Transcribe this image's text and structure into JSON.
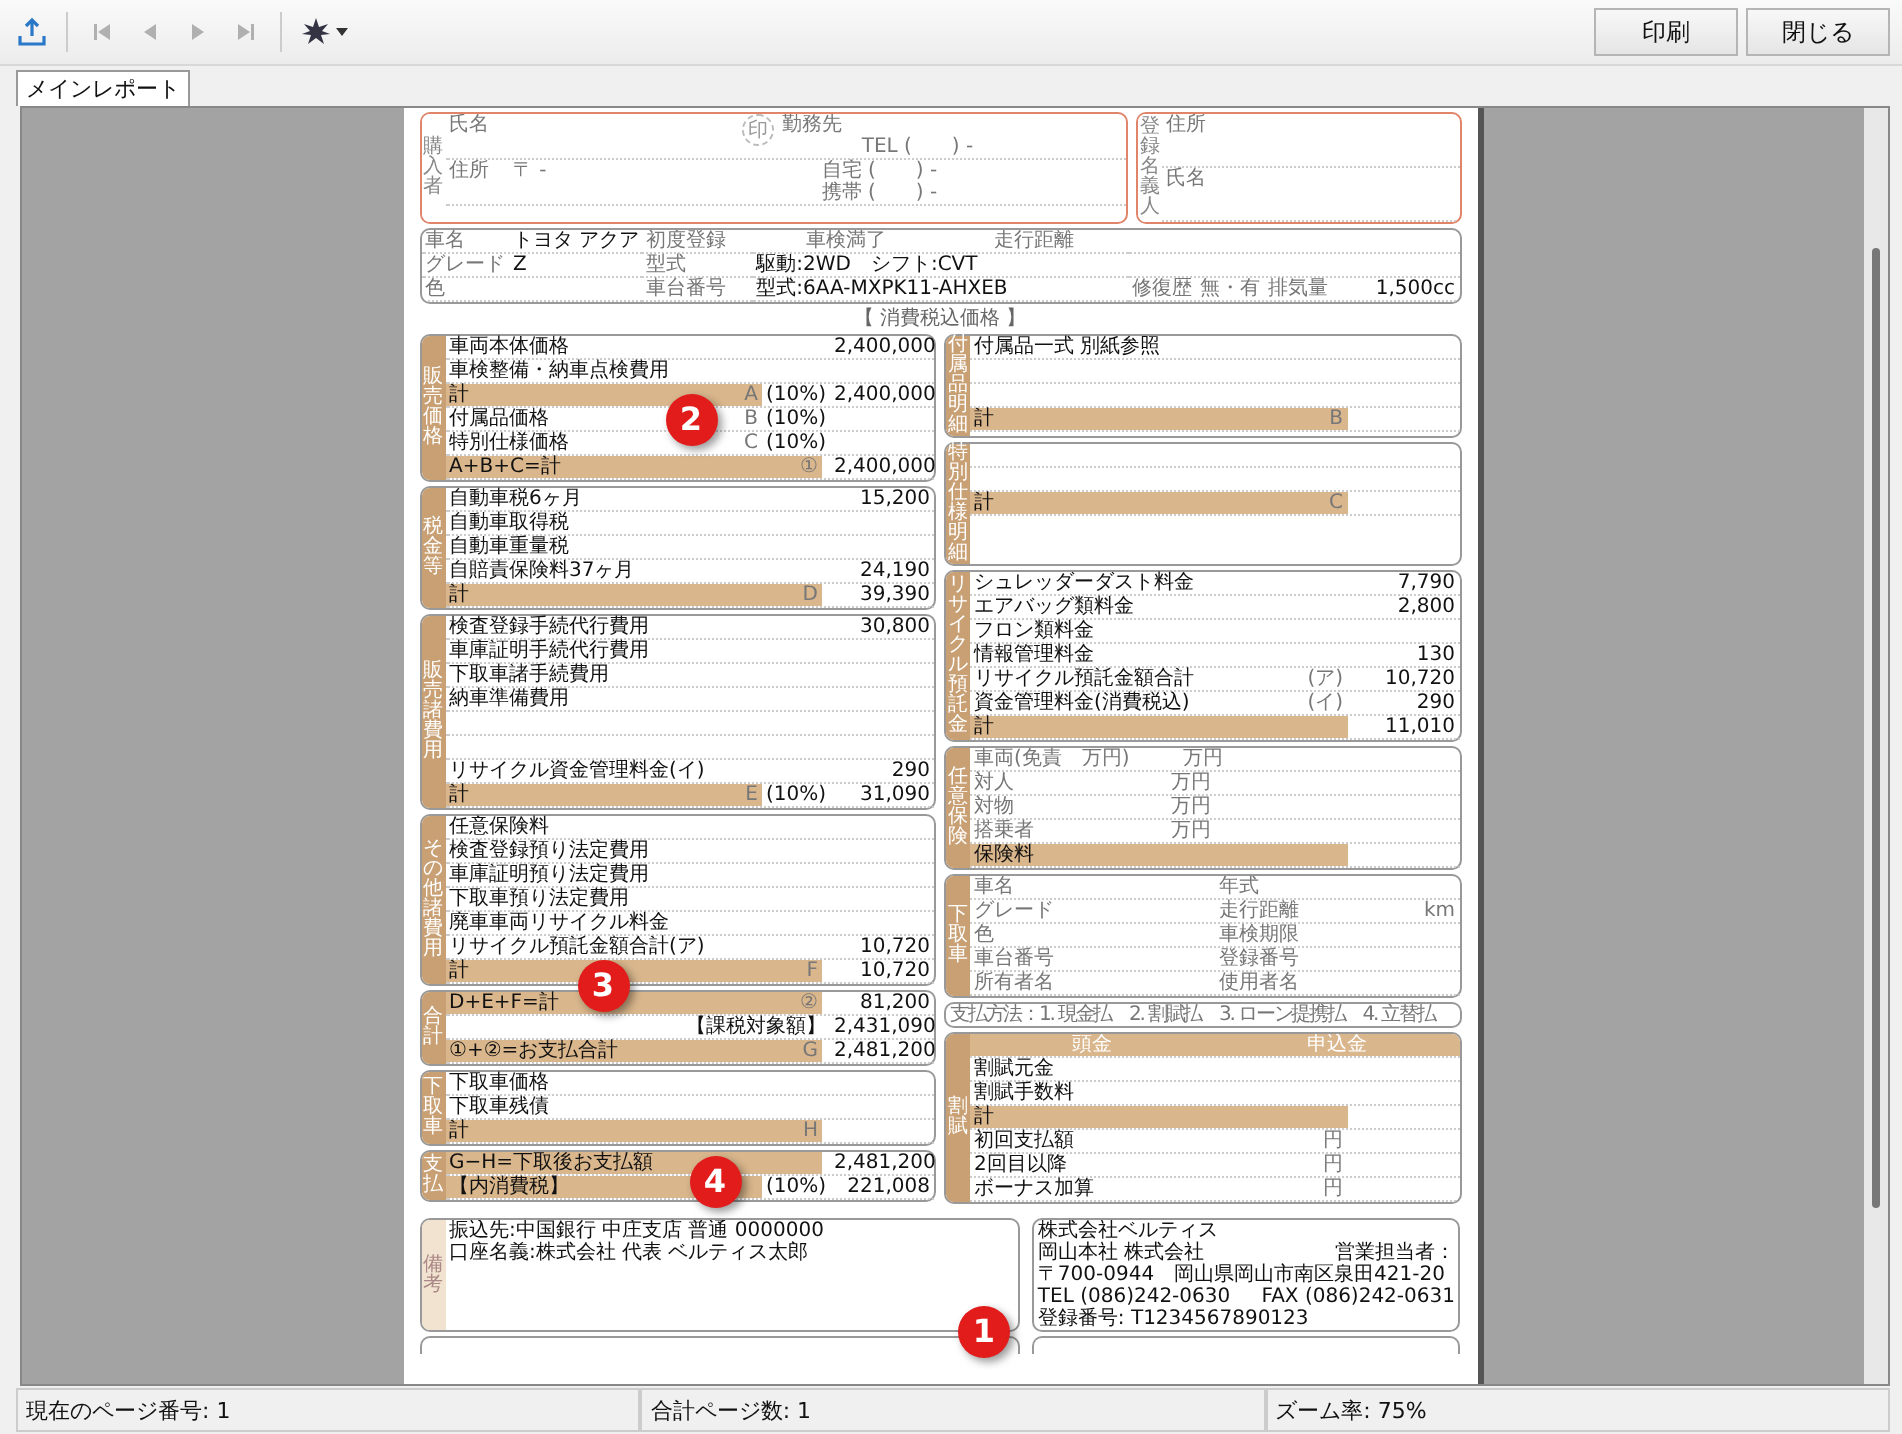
{
  "toolbar": {
    "tools": [
      {
        "kind": "export",
        "disabled": false
      },
      {
        "kind": "first",
        "disabled": true
      },
      {
        "kind": "prev",
        "disabled": true
      },
      {
        "kind": "next",
        "disabled": true
      },
      {
        "kind": "last",
        "disabled": true
      },
      {
        "kind": "zoom",
        "disabled": false
      }
    ],
    "buttons": [
      "印刷",
      "閉じる"
    ]
  },
  "tabs": [
    {
      "label": "メインレポート",
      "selected": true
    }
  ],
  "document": {
    "buyer": {
      "title": "購入者",
      "name_label": "氏名",
      "seal": "印",
      "workplace_label": "勤務先",
      "work_tel": "TEL (　　) -",
      "address_label": "住所",
      "postal": "〒 -",
      "home_tel": "自宅 (　　) -",
      "mobile_tel": "携帯 (　　) -"
    },
    "registrant": {
      "title": "登録名義人",
      "address_label": "住所",
      "name_label": "氏名"
    },
    "vehicle": {
      "name_label": "車名",
      "name": "トヨタ アクア",
      "grade_label": "グレード",
      "grade": "Z",
      "color_label": "色",
      "reg_labels": [
        "初度登録",
        "型式",
        "車台番号"
      ],
      "spec_lines": [
        "駆動:2WD　シフト:CVT",
        "型式:6AA-MXPK11-AHXEB"
      ],
      "head_labels": [
        "車検満了",
        "走行距離"
      ],
      "repair_label": "修復歴",
      "repair_value": "無・有",
      "displacement_label": "排気量",
      "displacement": "1,500cc"
    },
    "price_note": "【 消費税込価格 】",
    "left_sections": [
      {
        "title": "販売価格",
        "rows": [
          {
            "kind": "item",
            "label": "車両本体価格",
            "amount": "2,400,000"
          },
          {
            "kind": "item",
            "label": "車検整備・納車点検費用"
          },
          {
            "kind": "total",
            "label": "計",
            "mark": "A",
            "tax": "(10%)",
            "amount": "2,400,000"
          },
          {
            "kind": "item",
            "label": "付属品価格",
            "mark": "B",
            "tax": "(10%)"
          },
          {
            "kind": "item",
            "label": "特別仕様価格",
            "mark": "C",
            "tax": "(10%)"
          },
          {
            "kind": "total",
            "label": "A+B+C=計",
            "mark": "①",
            "amount": "2,400,000"
          }
        ]
      },
      {
        "title": "税金等",
        "rows": [
          {
            "kind": "item",
            "label": "自動車税6ヶ月",
            "amount": "15,200"
          },
          {
            "kind": "item",
            "label": "自動車取得税"
          },
          {
            "kind": "item",
            "label": "自動車重量税"
          },
          {
            "kind": "item",
            "label": "自賠責保険料37ヶ月",
            "amount": "24,190"
          },
          {
            "kind": "total",
            "label": "計",
            "mark": "D",
            "amount": "39,390"
          }
        ]
      },
      {
        "title": "販売諸費用",
        "rows": [
          {
            "kind": "item",
            "label": "検査登録手続代行費用",
            "amount": "30,800"
          },
          {
            "kind": "item",
            "label": "車庫証明手続代行費用"
          },
          {
            "kind": "item",
            "label": "下取車諸手続費用"
          },
          {
            "kind": "item",
            "label": "納車準備費用"
          },
          {
            "kind": "blank"
          },
          {
            "kind": "blank"
          },
          {
            "kind": "item",
            "label": "リサイクル資金管理料金(イ)",
            "amount": "290"
          },
          {
            "kind": "total",
            "label": "計",
            "mark": "E",
            "tax": "(10%)",
            "amount": "31,090"
          }
        ]
      },
      {
        "title": "その他諸費用",
        "rows": [
          {
            "kind": "item",
            "label": "任意保険料"
          },
          {
            "kind": "item",
            "label": "検査登録預り法定費用"
          },
          {
            "kind": "item",
            "label": "車庫証明預り法定費用"
          },
          {
            "kind": "item",
            "label": "下取車預り法定費用"
          },
          {
            "kind": "item",
            "label": "廃車車両リサイクル料金"
          },
          {
            "kind": "item",
            "label": "リサイクル預託金額合計(ア)",
            "amount": "10,720"
          },
          {
            "kind": "total",
            "label": "計",
            "mark": "F",
            "amount": "10,720"
          }
        ]
      },
      {
        "title": "合計",
        "rows": [
          {
            "kind": "total",
            "label": "D+E+F=計",
            "mark": "②",
            "amount": "81,200"
          },
          {
            "kind": "item",
            "tax": "【課税対象額】",
            "amount": "2,431,090"
          },
          {
            "kind": "total",
            "label": "①+②=お支払合計",
            "mark": "G",
            "amount": "2,481,200"
          }
        ]
      },
      {
        "title": "下取車",
        "rows": [
          {
            "kind": "item",
            "label": "下取車価格"
          },
          {
            "kind": "item",
            "label": "下取車残債"
          },
          {
            "kind": "total",
            "label": "計",
            "mark": "H"
          }
        ]
      },
      {
        "title": "支払",
        "rows": [
          {
            "kind": "total",
            "label": "G−H=下取後お支払額",
            "amount": "2,481,200"
          },
          {
            "kind": "total",
            "label": "【内消費税】",
            "tax": "(10%)",
            "amount": "221,008"
          }
        ]
      }
    ],
    "right_sections": [
      {
        "title": "付属品明細",
        "rows": [
          {
            "kind": "item",
            "label": "付属品一式 別紙参照"
          },
          {
            "kind": "blank"
          },
          {
            "kind": "blank"
          },
          {
            "kind": "total",
            "label": "計",
            "mark": "B"
          }
        ]
      },
      {
        "title": "特別仕様明細",
        "rows": [
          {
            "kind": "blank"
          },
          {
            "kind": "blank"
          },
          {
            "kind": "total",
            "label": "計",
            "mark": "C"
          }
        ]
      },
      {
        "title": "リサイクル預託金",
        "rows": [
          {
            "kind": "item",
            "label": "シュレッダーダスト料金",
            "amount": "7,790"
          },
          {
            "kind": "item",
            "label": "エアバッグ類料金",
            "amount": "2,800"
          },
          {
            "kind": "item",
            "label": "フロン類料金"
          },
          {
            "kind": "item",
            "label": "情報管理料金",
            "amount": "130"
          },
          {
            "kind": "item",
            "label": "リサイクル預託金額合計",
            "mark": "(ア)",
            "amount": "10,720"
          },
          {
            "kind": "item",
            "label": "資金管理料金(消費税込)",
            "mark": "(イ)",
            "amount": "290"
          },
          {
            "kind": "total",
            "label": "計",
            "amount": "11,010"
          }
        ]
      },
      {
        "title": "任意保険",
        "rows": [
          {
            "kind": "pair",
            "label": "車両(免責　万円)",
            "value": "万円"
          },
          {
            "kind": "pair",
            "label": "対人",
            "value": "万円"
          },
          {
            "kind": "pair",
            "label": "対物",
            "value": "万円"
          },
          {
            "kind": "pair",
            "label": "搭乗者",
            "value": "万円"
          },
          {
            "kind": "total",
            "label": "保険料"
          }
        ]
      },
      {
        "title": "下取車",
        "rows": [
          {
            "kind": "pair",
            "label": "車名",
            "label2": "年式"
          },
          {
            "kind": "pair",
            "label": "グレード",
            "label2": "走行距離",
            "value2": "km"
          },
          {
            "kind": "pair",
            "label": "色",
            "label2": "車検期限"
          },
          {
            "kind": "pair",
            "label": "車台番号",
            "label2": "登録番号"
          },
          {
            "kind": "pair",
            "label": "所有者名",
            "label2": "使用者名"
          }
        ]
      }
    ],
    "payment_methods": "支払方法：1. 現金払　2. 割賦払　3. ローン提携払　4. 立替払",
    "installment": {
      "title": "割賦",
      "headers": [
        "頭金",
        "申込金"
      ],
      "rows": [
        {
          "kind": "item",
          "label": "割賦元金"
        },
        {
          "kind": "item",
          "label": "割賦手数料"
        },
        {
          "kind": "total",
          "label": "計"
        },
        {
          "kind": "item",
          "label": "初回支払額",
          "mark": "円"
        },
        {
          "kind": "item",
          "label": "2回目以降",
          "mark": "円"
        },
        {
          "kind": "item",
          "label": "ボーナス加算",
          "mark": "円"
        }
      ]
    },
    "remarks": {
      "title": "備考",
      "lines": [
        "振込先:中国銀行 中庄支店 普通 0000000",
        "口座名義:株式会社 代表 ベルティス太郎"
      ]
    },
    "company": {
      "name": "株式会社ベルティス",
      "branch": "岡山本社 株式会社",
      "rep": "営業担当者：",
      "address": "〒700-0944　岡山県岡山市南区泉田421-20",
      "tel": "TEL (086)242-0630",
      "fax": "FAX (086)242-0631",
      "reg": "登録番号: T1234567890123"
    }
  },
  "markers": [
    "1",
    "2",
    "3",
    "4"
  ],
  "status_bar": [
    "現在のページ番号: 1",
    "合計ページ数: 1",
    "ズーム率: 75%"
  ]
}
